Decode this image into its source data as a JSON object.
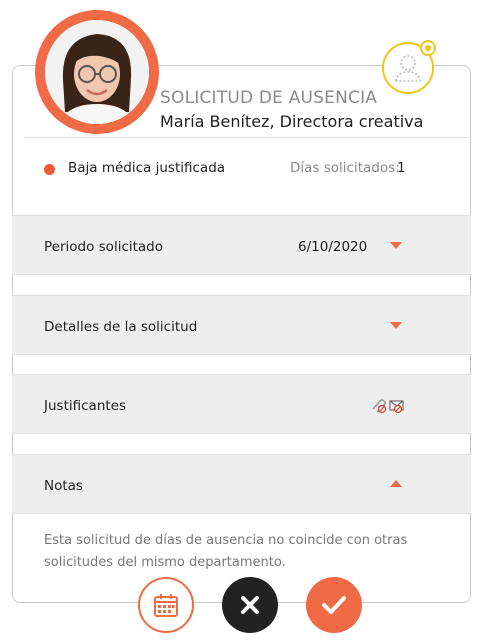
{
  "header": {
    "title": "SOLICITUD DE AUSENCIA",
    "employee": "María Benítez, Directora creativa"
  },
  "request": {
    "type": "Baja médica justificada",
    "days_label": "Días solicitados:",
    "days_value": "1"
  },
  "sections": {
    "period": {
      "label": "Periodo solicitado",
      "value": "6/10/2020"
    },
    "details": {
      "label": "Detalles de la solicitud"
    },
    "attachments": {
      "label": "Justificantes"
    },
    "notes": {
      "label": "Notas",
      "text": "Esta solicitud de días de ausencia no coincide con otras solicitudes del  mismo departamento."
    }
  },
  "colors": {
    "accent": "#ef6a45",
    "presence": "#f0c419",
    "dark_button": "#222222"
  },
  "icons": {
    "calendar": "calendar-icon",
    "reject": "close-icon",
    "accept": "check-icon",
    "attachment": "paperclip-icon",
    "mail": "mail-icon",
    "presence": "user-presence-icon"
  }
}
